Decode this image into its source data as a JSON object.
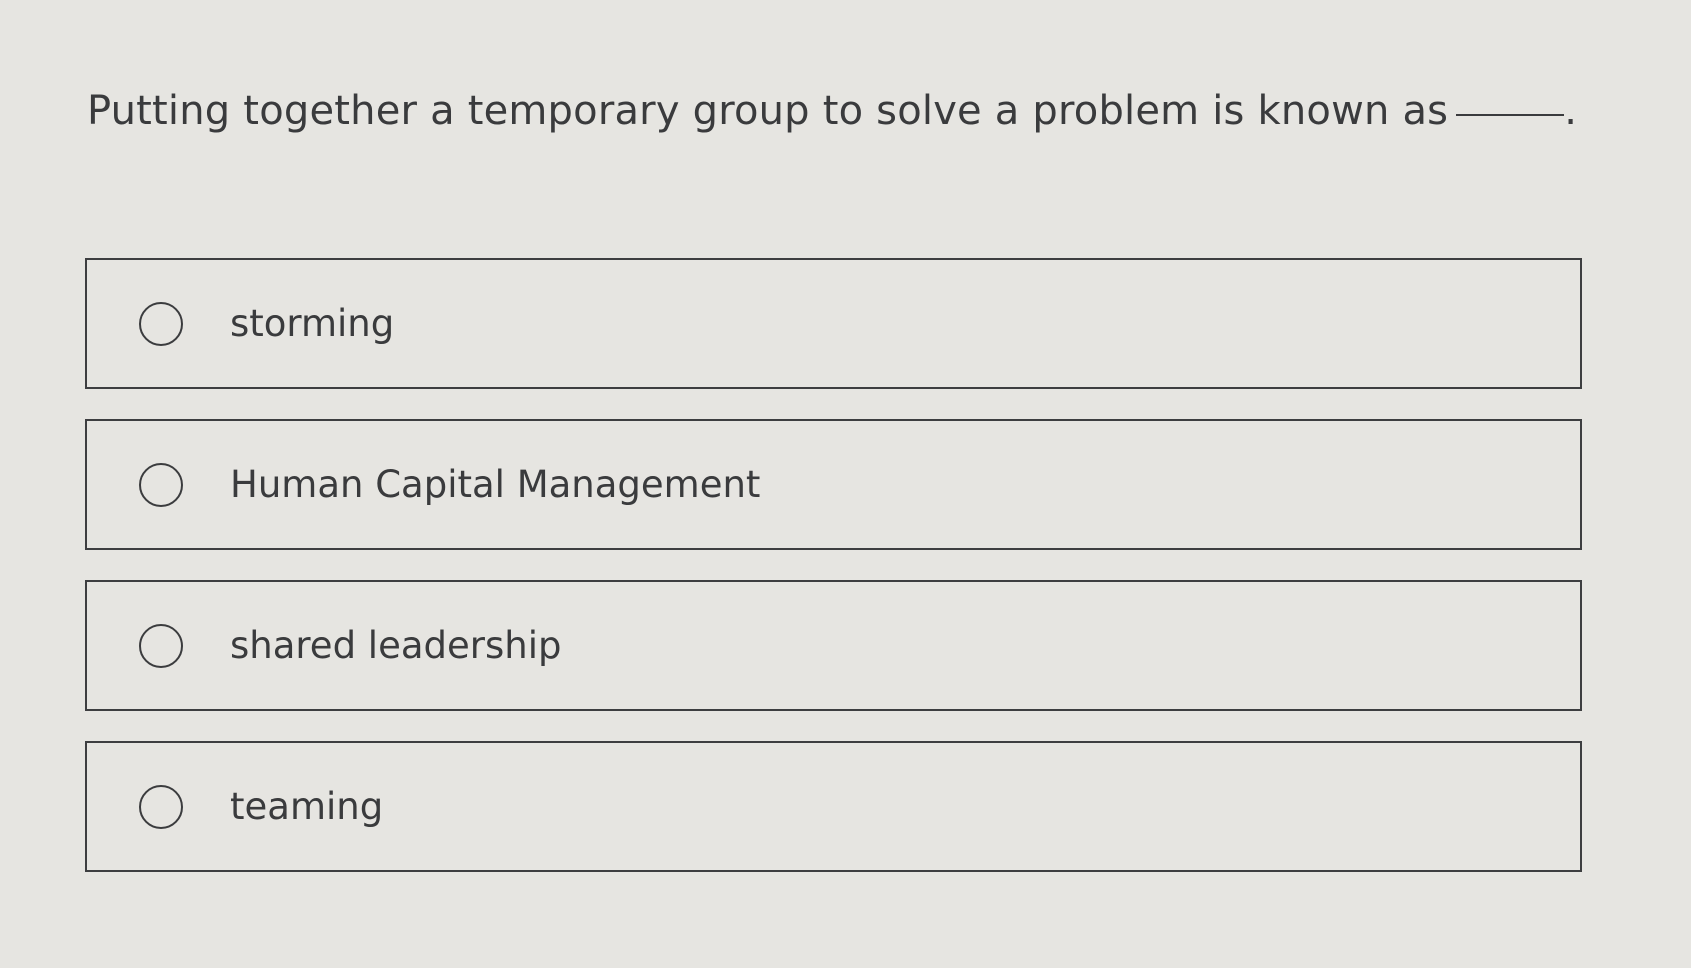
{
  "question": {
    "text": "Putting together a temporary group to solve a problem is known as",
    "end_punctuation": "."
  },
  "options": [
    {
      "label": "storming",
      "selected": false
    },
    {
      "label": "Human Capital Management",
      "selected": false
    },
    {
      "label": "shared leadership",
      "selected": false
    },
    {
      "label": "teaming",
      "selected": false
    }
  ]
}
